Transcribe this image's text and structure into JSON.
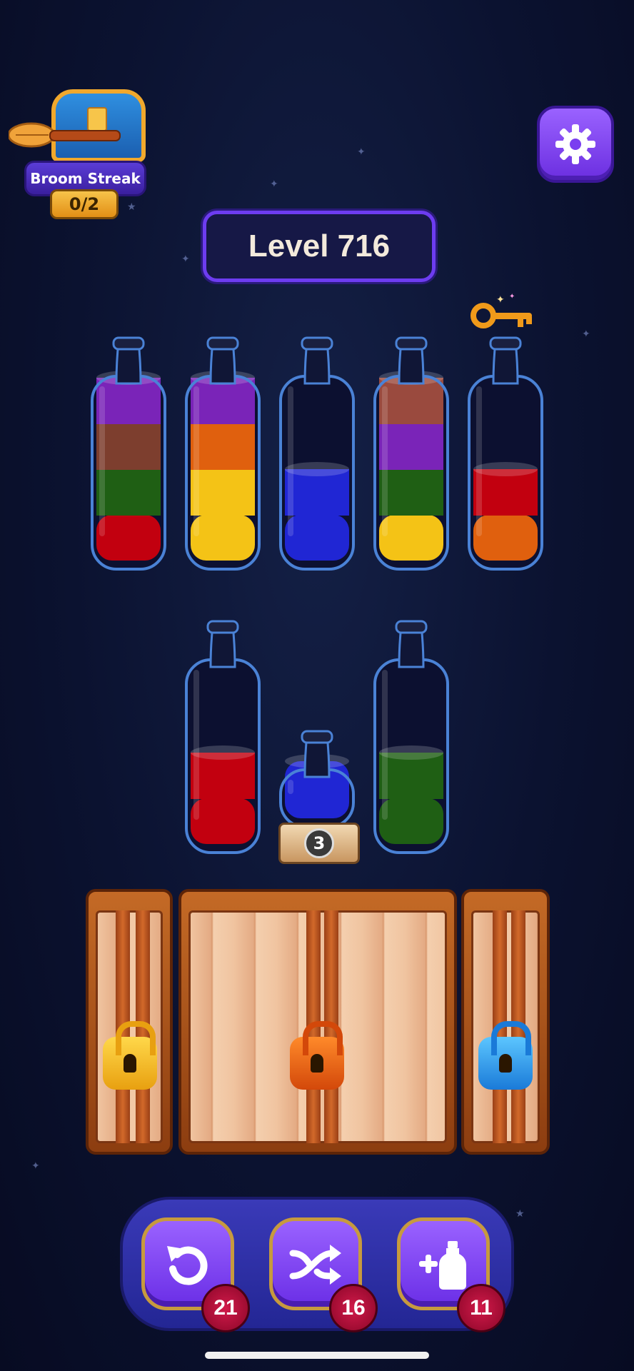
{
  "broom_streak": {
    "label": "Broom Streak",
    "progress": "0/2"
  },
  "level": {
    "label": "Level 716"
  },
  "settings": {
    "icon": "gear-icon"
  },
  "colors": {
    "purple": "#7a24b8",
    "brown": "#7d3e2e",
    "green": "#1f5f14",
    "red": "#c2000f",
    "orange": "#e0600e",
    "yellow": "#f4c316",
    "blue": "#2026d4",
    "rose": "#9a4a3e"
  },
  "tubes_row1": [
    {
      "layers": [
        "red",
        "green",
        "brown",
        "purple"
      ]
    },
    {
      "layers": [
        "yellow",
        "yellow",
        "orange",
        "purple"
      ]
    },
    {
      "layers": [
        "blue",
        "blue"
      ]
    },
    {
      "layers": [
        "yellow",
        "green",
        "purple",
        "rose"
      ]
    },
    {
      "layers": [
        "orange",
        "red"
      ],
      "has_key": true
    }
  ],
  "tubes_row2": [
    {
      "layers": [
        "red",
        "red"
      ]
    },
    {
      "layers": [
        "blue"
      ],
      "small": true,
      "capacity_badge": "3"
    },
    {
      "layers": [
        "green",
        "green"
      ]
    }
  ],
  "locked_crates": [
    {
      "lock_color": "yellow",
      "lock_icon": "yellow-padlock-icon"
    },
    {
      "lock_color": "orange",
      "lock_icon": "orange-padlock-icon"
    },
    {
      "lock_color": "blue",
      "lock_icon": "blue-padlock-icon"
    }
  ],
  "toolbar": {
    "undo": {
      "icon": "undo-icon",
      "count": "21"
    },
    "shuffle": {
      "icon": "shuffle-icon",
      "count": "16"
    },
    "add_bottle": {
      "icon": "add-bottle-icon",
      "count": "11"
    }
  }
}
